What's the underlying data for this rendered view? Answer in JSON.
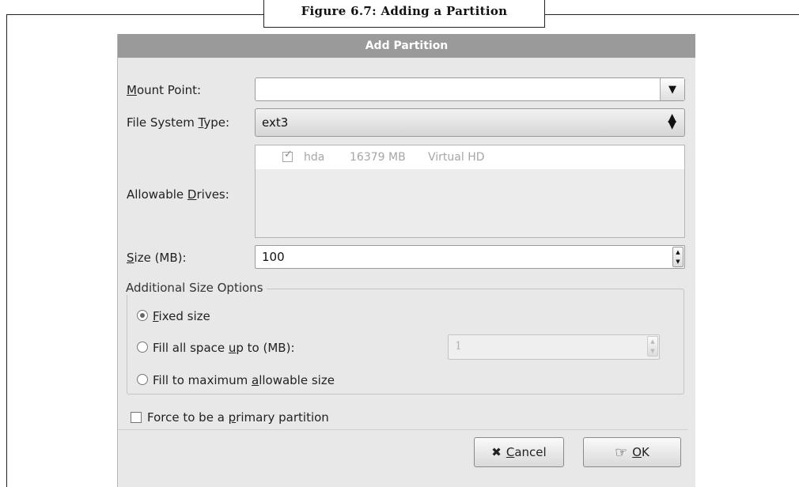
{
  "figure": {
    "caption": "Figure 6.7: Adding a Partition"
  },
  "dialog": {
    "title": "Add Partition",
    "mount_point": {
      "label": "Mount Point:",
      "value": ""
    },
    "fs_type": {
      "label": "File System Type:",
      "value": "ext3"
    },
    "drives": {
      "label": "Allowable Drives:",
      "items": [
        {
          "name": "hda",
          "size": "16379 MB",
          "model": "Virtual HD",
          "checked": true
        }
      ]
    },
    "size": {
      "label": "Size (MB):",
      "value": "100"
    },
    "size_options": {
      "title": "Additional Size Options",
      "fixed": "Fixed size",
      "fill_upto": "Fill all space up to (MB):",
      "fill_upto_value": "1",
      "fill_max": "Fill to maximum allowable size",
      "selected": "fixed"
    },
    "primary": {
      "label": "Force to be a primary partition",
      "checked": false
    },
    "buttons": {
      "cancel": "Cancel",
      "ok": "OK"
    }
  }
}
